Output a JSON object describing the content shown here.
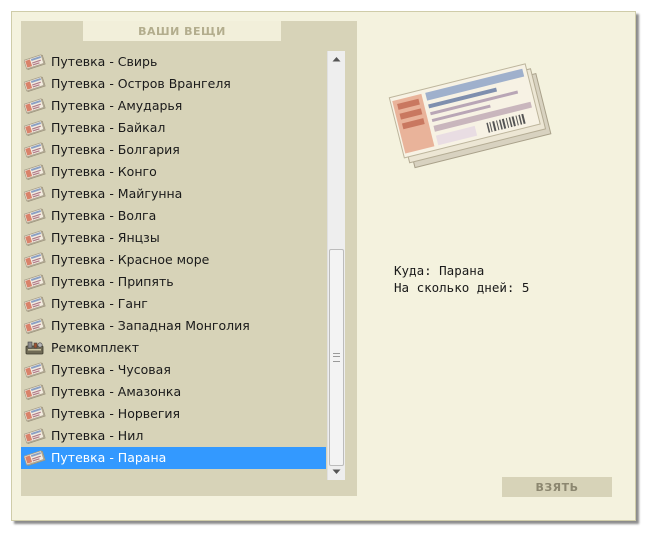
{
  "panel": {
    "header": "ВАШИ ВЕЩИ"
  },
  "items": [
    {
      "label": "Путевка - Свирь",
      "icon": "ticket-icon"
    },
    {
      "label": "Путевка - Остров Врангеля",
      "icon": "ticket-icon"
    },
    {
      "label": "Путевка - Амударья",
      "icon": "ticket-icon"
    },
    {
      "label": "Путевка - Байкал",
      "icon": "ticket-icon"
    },
    {
      "label": "Путевка - Болгария",
      "icon": "ticket-icon"
    },
    {
      "label": "Путевка - Конго",
      "icon": "ticket-icon"
    },
    {
      "label": "Путевка - Майгунна",
      "icon": "ticket-icon"
    },
    {
      "label": "Путевка - Волга",
      "icon": "ticket-icon"
    },
    {
      "label": "Путевка - Янцзы",
      "icon": "ticket-icon"
    },
    {
      "label": "Путевка - Красное море",
      "icon": "ticket-icon"
    },
    {
      "label": "Путевка - Припять",
      "icon": "ticket-icon"
    },
    {
      "label": "Путевка - Ганг",
      "icon": "ticket-icon"
    },
    {
      "label": "Путевка - Западная Монголия",
      "icon": "ticket-icon"
    },
    {
      "label": "Ремкомплект",
      "icon": "repair-kit-icon"
    },
    {
      "label": "Путевка - Чусовая",
      "icon": "ticket-icon"
    },
    {
      "label": "Путевка - Амазонка",
      "icon": "ticket-icon"
    },
    {
      "label": "Путевка - Норвегия",
      "icon": "ticket-icon"
    },
    {
      "label": "Путевка - Нил",
      "icon": "ticket-icon"
    },
    {
      "label": "Путевка - Парана",
      "icon": "ticket-icon",
      "selected": true
    }
  ],
  "details": {
    "destination": "Куда: Парана",
    "days": "На сколько дней: 5",
    "image": "travel-voucher-image"
  },
  "actions": {
    "take_label": "ВЗЯТЬ"
  },
  "colors": {
    "selection": "#3399ff",
    "panel": "#d7d3b8",
    "background": "#f4f2de"
  }
}
